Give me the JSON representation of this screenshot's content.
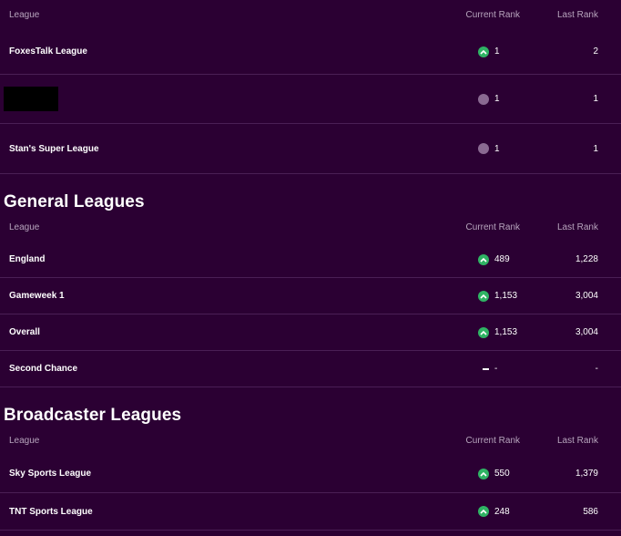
{
  "private_leagues": {
    "header": {
      "league": "League",
      "current_rank": "Current Rank",
      "last_rank": "Last Rank"
    },
    "rows": [
      {
        "name": "FoxesTalk League",
        "movement": "up",
        "current_rank": "1",
        "last_rank": "2"
      },
      {
        "name": "",
        "movement": "same",
        "current_rank": "1",
        "last_rank": "1"
      },
      {
        "name": "Stan's Super League",
        "movement": "same",
        "current_rank": "1",
        "last_rank": "1"
      }
    ]
  },
  "general_leagues": {
    "title": "General Leagues",
    "header": {
      "league": "League",
      "current_rank": "Current Rank",
      "last_rank": "Last Rank"
    },
    "rows": [
      {
        "name": "England",
        "movement": "up",
        "current_rank": "489",
        "last_rank": "1,228"
      },
      {
        "name": "Gameweek 1",
        "movement": "up",
        "current_rank": "1,153",
        "last_rank": "3,004"
      },
      {
        "name": "Overall",
        "movement": "up",
        "current_rank": "1,153",
        "last_rank": "3,004"
      },
      {
        "name": "Second Chance",
        "movement": "none",
        "current_rank": "-",
        "last_rank": "-"
      }
    ]
  },
  "broadcaster_leagues": {
    "title": "Broadcaster Leagues",
    "header": {
      "league": "League",
      "current_rank": "Current Rank",
      "last_rank": "Last Rank"
    },
    "rows": [
      {
        "name": "Sky Sports League",
        "movement": "up",
        "current_rank": "550",
        "last_rank": "1,379"
      },
      {
        "name": "TNT Sports League",
        "movement": "up",
        "current_rank": "248",
        "last_rank": "586"
      }
    ]
  },
  "colors": {
    "background": "#2b0033",
    "up": "#2fb364",
    "same": "#8a6a92",
    "divider": "#4a1f55"
  }
}
